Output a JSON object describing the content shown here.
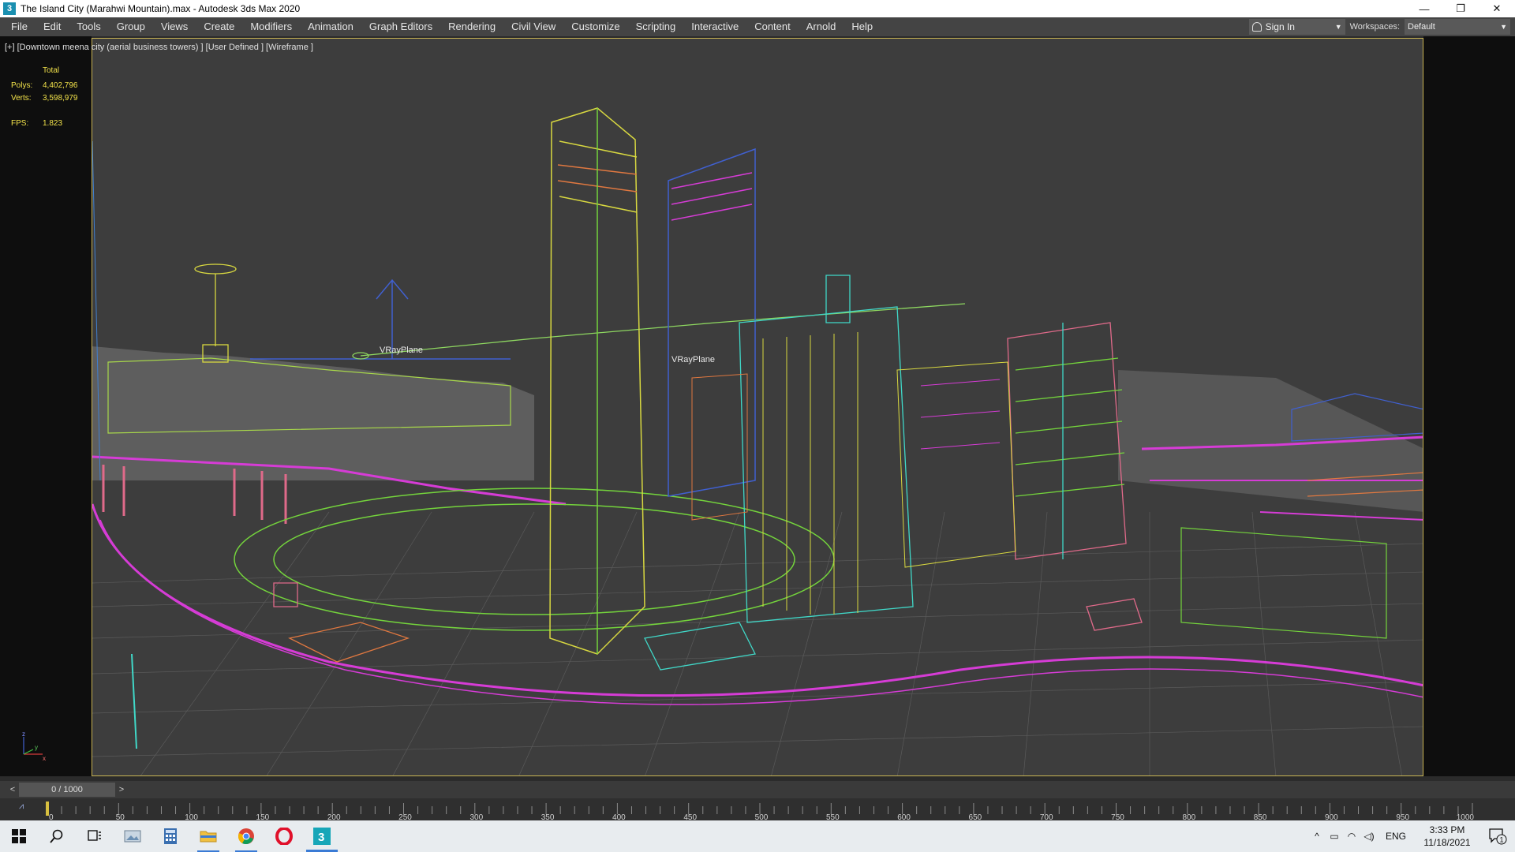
{
  "window": {
    "title": "The Island City (Marahwi Mountain).max - Autodesk 3ds Max 2020",
    "app_icon": "3",
    "minimize": "—",
    "restore": "❐",
    "close": "✕"
  },
  "menu": {
    "items": [
      "File",
      "Edit",
      "Tools",
      "Group",
      "Views",
      "Create",
      "Modifiers",
      "Animation",
      "Graph Editors",
      "Rendering",
      "Civil View",
      "Customize",
      "Scripting",
      "Interactive",
      "Content",
      "Arnold",
      "Help"
    ],
    "sign_in": "Sign In",
    "workspaces_label": "Workspaces:",
    "workspace_value": "Default"
  },
  "viewport": {
    "label": "[+] [Downtown meena city (aerial business towers) ] [User Defined ] [Wireframe ]",
    "stats": {
      "total_label": "Total",
      "polys_label": "Polys:",
      "polys_value": "4,402,796",
      "verts_label": "Verts:",
      "verts_value": "3,598,979",
      "fps_label": "FPS:",
      "fps_value": "1.823"
    },
    "object_labels": [
      "VRayPlane",
      "VRayPlane"
    ],
    "axis_labels": {
      "z": "z",
      "x": "x",
      "y": "y"
    },
    "colors": {
      "magenta": "#d63cd6",
      "yellow": "#d8d840",
      "green": "#74d43c",
      "cyan": "#40d8c8",
      "pink": "#e06a8a",
      "blue": "#4060d0",
      "orange": "#e07840",
      "grid": "#5a5a5a",
      "terrain": "#7a7a7a"
    }
  },
  "timeline": {
    "frame_display": "0 / 1000",
    "prev": "<",
    "next": ">",
    "ticks": [
      "0",
      "50",
      "100",
      "150",
      "200",
      "250",
      "300",
      "350",
      "400",
      "450",
      "500",
      "550",
      "600",
      "650",
      "700",
      "750",
      "800",
      "850",
      "900",
      "950",
      "1000"
    ]
  },
  "taskbar": {
    "language": "ENG",
    "time": "3:33 PM",
    "date": "11/18/2021",
    "notification_count": "1",
    "app_3dsmax": "3"
  }
}
